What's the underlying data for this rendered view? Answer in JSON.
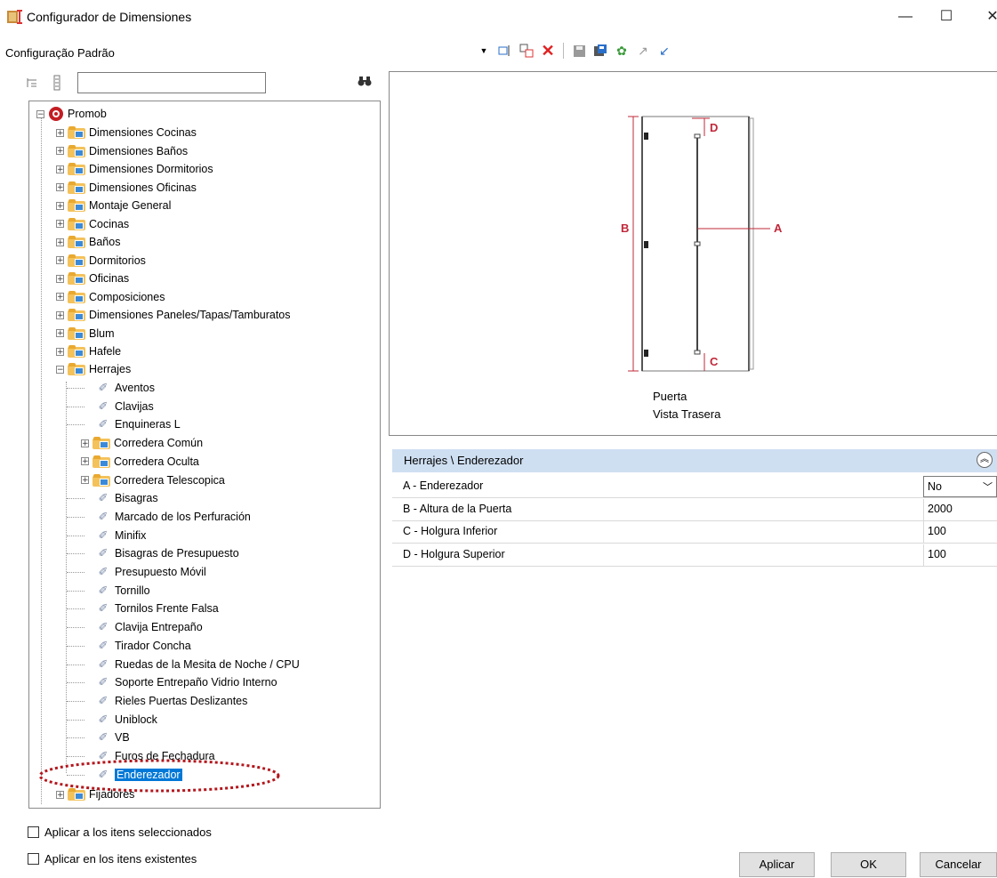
{
  "window": {
    "title": "Configurador de Dimensiones",
    "minimize": "—",
    "maximize": "☐",
    "close": "✕"
  },
  "config_label": "Configuração Padrão",
  "tree": {
    "root": "Promob",
    "folders_top": [
      "Dimensiones Cocinas",
      "Dimensiones Baños",
      "Dimensiones Dormitorios",
      "Dimensiones Oficinas",
      "Montaje General",
      "Cocinas",
      "Baños",
      "Dormitorios",
      "Oficinas",
      "Composiciones",
      "Dimensiones Paneles/Tapas/Tamburatos",
      "Blum",
      "Hafele"
    ],
    "herrajes": "Herrajes",
    "herrajes_children": [
      {
        "label": "Aventos",
        "type": "leaf"
      },
      {
        "label": "Clavijas",
        "type": "leaf"
      },
      {
        "label": "Enquineras L",
        "type": "leaf"
      },
      {
        "label": "Corredera Común",
        "type": "folder"
      },
      {
        "label": "Corredera Oculta",
        "type": "folder"
      },
      {
        "label": "Corredera Telescopica",
        "type": "folder"
      },
      {
        "label": "Bisagras",
        "type": "leaf"
      },
      {
        "label": "Marcado de los Perfuración",
        "type": "leaf"
      },
      {
        "label": "Minifix",
        "type": "leaf"
      },
      {
        "label": "Bisagras de Presupuesto",
        "type": "leaf"
      },
      {
        "label": "Presupuesto Móvil",
        "type": "leaf"
      },
      {
        "label": "Tornillo",
        "type": "leaf"
      },
      {
        "label": "Tornilos Frente Falsa",
        "type": "leaf"
      },
      {
        "label": "Clavija Entrepaño",
        "type": "leaf"
      },
      {
        "label": "Tirador Concha",
        "type": "leaf"
      },
      {
        "label": "Ruedas de la Mesita de Noche / CPU",
        "type": "leaf"
      },
      {
        "label": "Soporte Entrepaño Vidrio Interno",
        "type": "leaf"
      },
      {
        "label": "Rieles Puertas Deslizantes",
        "type": "leaf"
      },
      {
        "label": "Uniblock",
        "type": "leaf"
      },
      {
        "label": "VB",
        "type": "leaf"
      },
      {
        "label": "Furos de Fechadura",
        "type": "leaf"
      },
      {
        "label": "Enderezador",
        "type": "leaf",
        "selected": true
      }
    ],
    "last_folder": "Fijadores"
  },
  "checkboxes": {
    "apply_selected": "Aplicar a los itens seleccionados",
    "apply_existing": "Aplicar en los itens existentes"
  },
  "preview": {
    "caption_line1": "Puerta",
    "caption_line2": "Vista Trasera",
    "label_a": "A",
    "label_b": "B",
    "label_c": "C",
    "label_d": "D",
    "accent_color": "#c0283a"
  },
  "property_grid": {
    "title": "Herrajes \\ Enderezador",
    "rows": [
      {
        "name": "A - Enderezador",
        "value": "No",
        "dropdown": true
      },
      {
        "name": "B - Altura de la Puerta",
        "value": "2000"
      },
      {
        "name": "C - Holgura Inferior",
        "value": "100"
      },
      {
        "name": "D - Holgura Superior",
        "value": "100"
      }
    ]
  },
  "buttons": {
    "apply": "Aplicar",
    "ok": "OK",
    "cancel": "Cancelar"
  },
  "icons": [
    "app-icon",
    "dropdown-arrow-icon",
    "rename-icon",
    "copy-icon",
    "delete-icon",
    "save-icon",
    "save-as-icon",
    "settings-icon",
    "export-icon",
    "import-icon",
    "collapse-all-icon",
    "expand-all-icon",
    "binoculars-icon",
    "collapse-circle-icon"
  ]
}
